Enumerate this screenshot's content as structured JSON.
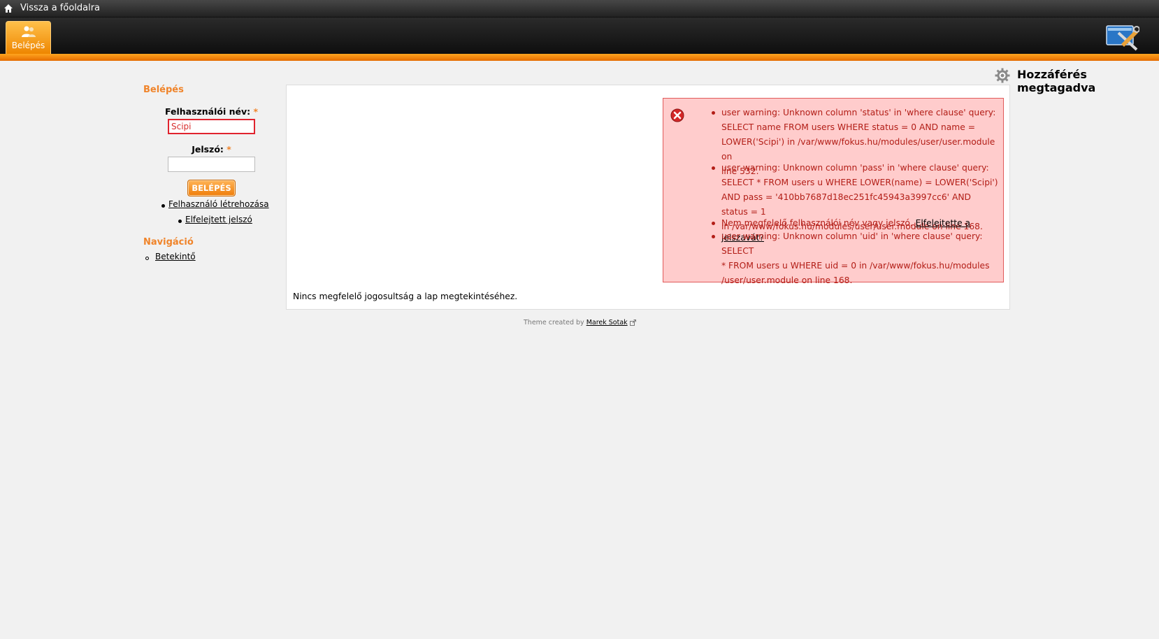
{
  "topbar": {
    "home_link": "Vissza a főoldalra"
  },
  "header": {
    "login_tab_label": "Belépés",
    "accent_color": "#f58a1a"
  },
  "page": {
    "title": "Hozzáférés megtagadva"
  },
  "sidebar": {
    "login_block": {
      "title": "Belépés",
      "username_label": "Felhasználói név:",
      "username_value": "Scipi",
      "password_label": "Jelszó:",
      "password_value": "",
      "required_mark": "*",
      "submit_label": "BELÉPÉS",
      "links": [
        "Felhasználó létrehozása",
        "Elfelejtett jelszó"
      ]
    },
    "nav_block": {
      "title": "Navigáció",
      "items": [
        "Betekintő"
      ]
    }
  },
  "messages": [
    {
      "lines": [
        "user warning: Unknown column 'status' in 'where clause' query:",
        "SELECT name FROM users WHERE status = 0 AND name =",
        "LOWER('Scipi') in /var/www/fokus.hu/modules/user/user.module on",
        "line 532."
      ]
    },
    {
      "lines": [
        "user warning: Unknown column 'pass' in 'where clause' query:",
        "SELECT * FROM users u WHERE LOWER(name) = LOWER('Scipi')",
        "AND pass = '410bb7687d18ec251fc45943a3997cc6' AND status = 1",
        "in /var/www/fokus.hu/modules/user/user.module on line 168."
      ]
    },
    {
      "text": "Nem megfelelő felhasználói név vagy jelszó.",
      "link": "Elfelejtette a jelszavát?"
    },
    {
      "lines": [
        "user warning: Unknown column 'uid' in 'where clause' query: SELECT",
        "* FROM users u WHERE uid = 0 in /var/www/fokus.hu/modules",
        "/user/user.module on line 168."
      ]
    }
  ],
  "content": {
    "no_access_text": "Nincs megfelelő jogosultság a lap megtekintéséhez."
  },
  "footer": {
    "prefix": "Theme created by",
    "author": "Marek Sotak"
  }
}
